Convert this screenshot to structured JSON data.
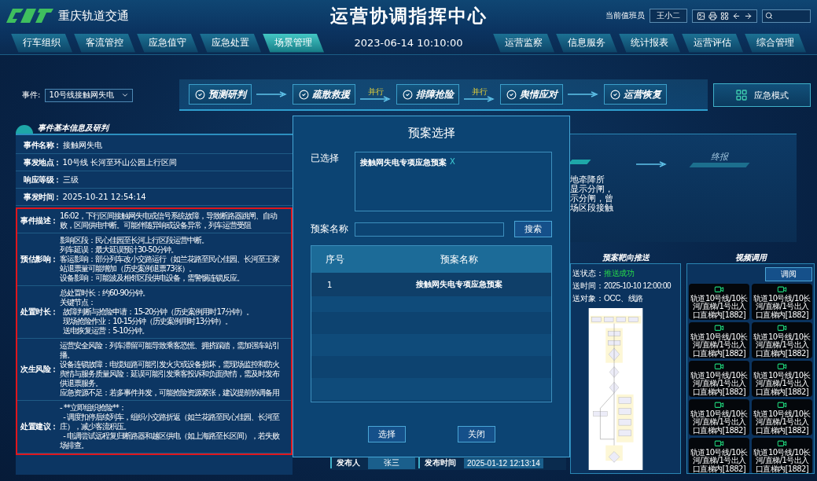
{
  "header": {
    "logo_text": "重庆轨道交通",
    "title": "运营协调指挥中心",
    "duty_label": "当前值班员",
    "duty_name": "王小二"
  },
  "nav": {
    "left_tabs": [
      {
        "label": "行车组织",
        "selected": false
      },
      {
        "label": "客流管控",
        "selected": false
      },
      {
        "label": "应急值守",
        "selected": false
      },
      {
        "label": "应急处置",
        "selected": false
      },
      {
        "label": "场景管理",
        "selected": true
      }
    ],
    "datetime": "2023-06-14 10:10:00",
    "right_tabs": [
      {
        "label": "运营监察",
        "selected": false
      },
      {
        "label": "信息服务",
        "selected": false
      },
      {
        "label": "统计报表",
        "selected": false
      },
      {
        "label": "运营评估",
        "selected": false
      },
      {
        "label": "综合管理",
        "selected": false
      }
    ]
  },
  "event_select": {
    "label": "事件:",
    "value": "10号线接触网失电"
  },
  "workflow": {
    "steps": [
      "预测研判",
      "疏散救援",
      "排障抢险",
      "舆情应对",
      "运营恢复"
    ],
    "connectors": [
      {
        "kind": "arrow"
      },
      {
        "kind": "parallel",
        "label": "并行"
      },
      {
        "kind": "parallel",
        "label": "并行"
      },
      {
        "kind": "arrow"
      }
    ]
  },
  "emergency_button": {
    "label": "应急模式"
  },
  "event_panel": {
    "title": "事件基本信息及研判",
    "highlighted": true,
    "fields": [
      {
        "label": "事件名称：",
        "value": "接触网失电"
      },
      {
        "label": "事发地点：",
        "value": "10号线 长河至环山公园上行区间"
      },
      {
        "label": "响应等级：",
        "value": "三级"
      },
      {
        "label": "事发时间：",
        "value": "2025-10-21 12:54:14"
      }
    ],
    "analysis": [
      {
        "label": "事件描述：",
        "lines": [
          "16:02，下行区间接触网失电或信号系统故障，导致断路器跳闸、自动",
          "败，区间供电中断。可能伴随异响或设备异常，列车运营受阻"
        ]
      },
      {
        "label": "预估影响：",
        "lines": [
          "影响区段：民心佳园至长河上行区段运营中断。",
          "列车延误：最大延误预计30-50分钟。",
          "客运影响：部分列车改小交路运行（如兰花路至民心佳园、长河至王家",
          "站退票量可能增加（历史案例退票73张）。",
          "设备影响：可能波及相邻区段供电设备，需警惕连锁反应。"
        ]
      },
      {
        "label": "处置时长：",
        "lines": [
          "总处置时长：约60-90分钟。",
          "关键节点：",
          "  故障判断与抢险申请：15-20分钟（历史案例用时17分钟）。",
          "  现场抢险作业：10-15分钟（历史案例用时13分钟）。",
          "  送电恢复运营：5-10分钟。"
        ]
      },
      {
        "label": "次生风险：",
        "lines": [
          "运营安全风险：列车滞留可能导致乘客恐慌、拥挤踩踏，需加强车站引",
          "播。",
          "设备连锁故障：电缆短路可能引发火灾或设备损坏，需现场监控和防火",
          "舆情与服务质量风险：延误可能引发乘客投诉和负面舆情，需及时发布",
          "供退票服务。",
          "应急资源不足：若多事件并发，可能抢险资源紧张，建议提前协调备用"
        ]
      },
      {
        "label": "处置建议：",
        "lines": [
          "- **立即组织抢险**：",
          "  - 调度扣停后续列车，组织小交路折返（如兰花路至民心佳园、长河至",
          "庄），减少客流积压。",
          "  - 电调尝试远程复归断路器和越区供电（如上海路至长区间），若失败",
          "场排查。"
        ]
      }
    ]
  },
  "stage_panel": {
    "stage_label": "终报",
    "lines": [
      "地牵降所",
      "显示分闸，",
      "示分闸，曾",
      "场区段接触"
    ]
  },
  "push_panel": {
    "title": "预案靶向推送",
    "fields": [
      {
        "kind": "status",
        "label": "送状态：",
        "value": "推送成功"
      },
      {
        "kind": "text",
        "label": "送时间：",
        "value": "2025-10-10 12:00:00"
      },
      {
        "kind": "text",
        "label": "送对象：",
        "value": "OCC、线路"
      }
    ]
  },
  "video_panel": {
    "title": "视频调用",
    "button": "调阅",
    "cameras": [
      {
        "label": "轨道10号线/10长河/直梯/1号出入口直梯内[1882]"
      },
      {
        "label": "轨道10号线/10长河/直梯/1号出入口直梯内[1882]"
      },
      {
        "label": "轨道10号线/10长河/直梯/1号出入口直梯内[1882]"
      },
      {
        "label": "轨道10号线/10长河/直梯/1号出入口直梯内[1882]"
      },
      {
        "label": "轨道10号线/10长河/直梯/1号出入口直梯内[1882]"
      },
      {
        "label": "轨道10号线/10长河/直梯/1号出入口直梯内[1882]"
      },
      {
        "label": "轨道10号线/10长河/直梯/1号出入口直梯内[1882]"
      },
      {
        "label": "轨道10号线/10长河/直梯/1号出入口直梯内[1882]"
      },
      {
        "label": "轨道10号线/10长河/直梯/1号出入口直梯内[1882]"
      },
      {
        "label": "轨道10号线/10长河/直梯/1号出入口直梯内[1882]"
      }
    ]
  },
  "publish_bar": {
    "publisher_label": "发布人",
    "publisher": "张三",
    "time_label": "发布时间",
    "time": "2025-01-12 12:13:14"
  },
  "dialog": {
    "title": "预案选择",
    "selected_label": "已选择",
    "selected_tags": [
      {
        "label": "接触网失电专项应急预案",
        "remove": "X"
      }
    ],
    "search_label": "预案名称",
    "search_button": "搜索",
    "table": {
      "columns": [
        "序号",
        "预案名称"
      ],
      "rows": [
        {
          "index": "1",
          "name": "接触网失电专项应急预案"
        }
      ]
    },
    "buttons": [
      "选择",
      "关闭"
    ]
  }
}
